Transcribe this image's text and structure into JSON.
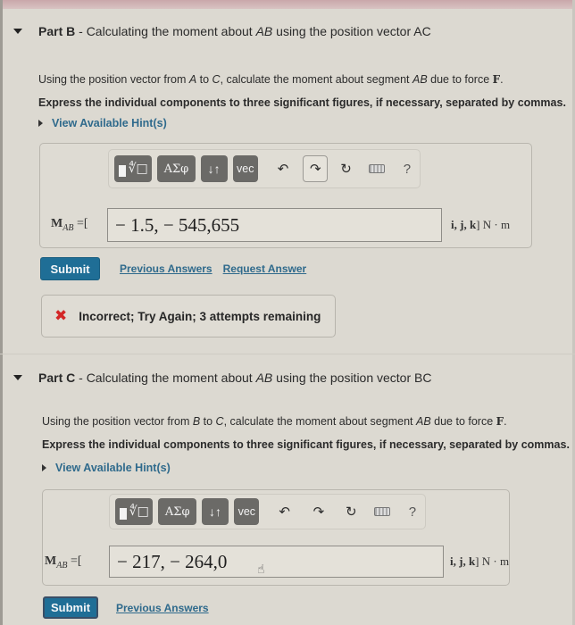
{
  "part_b": {
    "label": "Part B",
    "title_sep": " - ",
    "title_pre": "Calculating the moment about ",
    "title_em": "AB",
    "title_post": " using the position vector AC",
    "desc": {
      "t1": "Using the position vector from ",
      "e1": "A",
      "t2": " to ",
      "e2": "C",
      "t3": ", calculate the moment about segment ",
      "e3": "AB",
      "t4": " due to force ",
      "force": "F",
      "t5": "."
    },
    "instruction": "Express the individual components to three significant figures, if necessary, separated by commas.",
    "hint_label": "View Available Hint(s)",
    "toolbar": {
      "template_icon": "template-root-icon",
      "greek_label": "ΑΣφ",
      "arrows_label": "↓↑",
      "vec_label": "vec",
      "undo_icon": "undo-icon",
      "redo_icon": "redo-icon",
      "reset_icon": "reset-icon",
      "keyboard_icon": "keyboard-icon",
      "help_label": "?"
    },
    "math_label": {
      "bold": "M",
      "sub": "AB",
      "suffix": " =["
    },
    "answer_value": "− 1.5, − 545,655",
    "units": {
      "vec": "i, j, k",
      "suffix": "] N · m"
    },
    "submit_label": "Submit",
    "links": [
      "Previous Answers",
      "Request Answer"
    ],
    "feedback": {
      "icon": "x-icon",
      "text": "Incorrect; Try Again; 3 attempts remaining",
      "color": "#d32626"
    }
  },
  "part_c": {
    "label": "Part C",
    "title_sep": " - ",
    "title_pre": "Calculating the moment about ",
    "title_em": "AB",
    "title_post": " using the position vector BC",
    "desc": {
      "t1": "Using the position vector from ",
      "e1": "B",
      "t2": " to ",
      "e2": "C",
      "t3": ", calculate the moment about segment ",
      "e3": "AB",
      "t4": " due to force ",
      "force": "F",
      "t5": "."
    },
    "instruction": "Express the individual components to three significant figures, if necessary, separated by commas.",
    "hint_label": "View Available Hint(s)",
    "toolbar": {
      "greek_label": "ΑΣφ",
      "arrows_label": "↓↑",
      "vec_label": "vec",
      "help_label": "?"
    },
    "math_label": {
      "bold": "M",
      "sub": "AB",
      "suffix": " =["
    },
    "answer_value": "− 217, − 264,0",
    "units": {
      "vec": "i, j, k",
      "suffix": "] N · m"
    },
    "submit_label": "Submit",
    "links": [
      "Previous Answers"
    ]
  },
  "colors": {
    "accent": "#1f6e96",
    "link": "#2f6a8c",
    "error": "#d32626",
    "background": "#dcd9d1"
  }
}
